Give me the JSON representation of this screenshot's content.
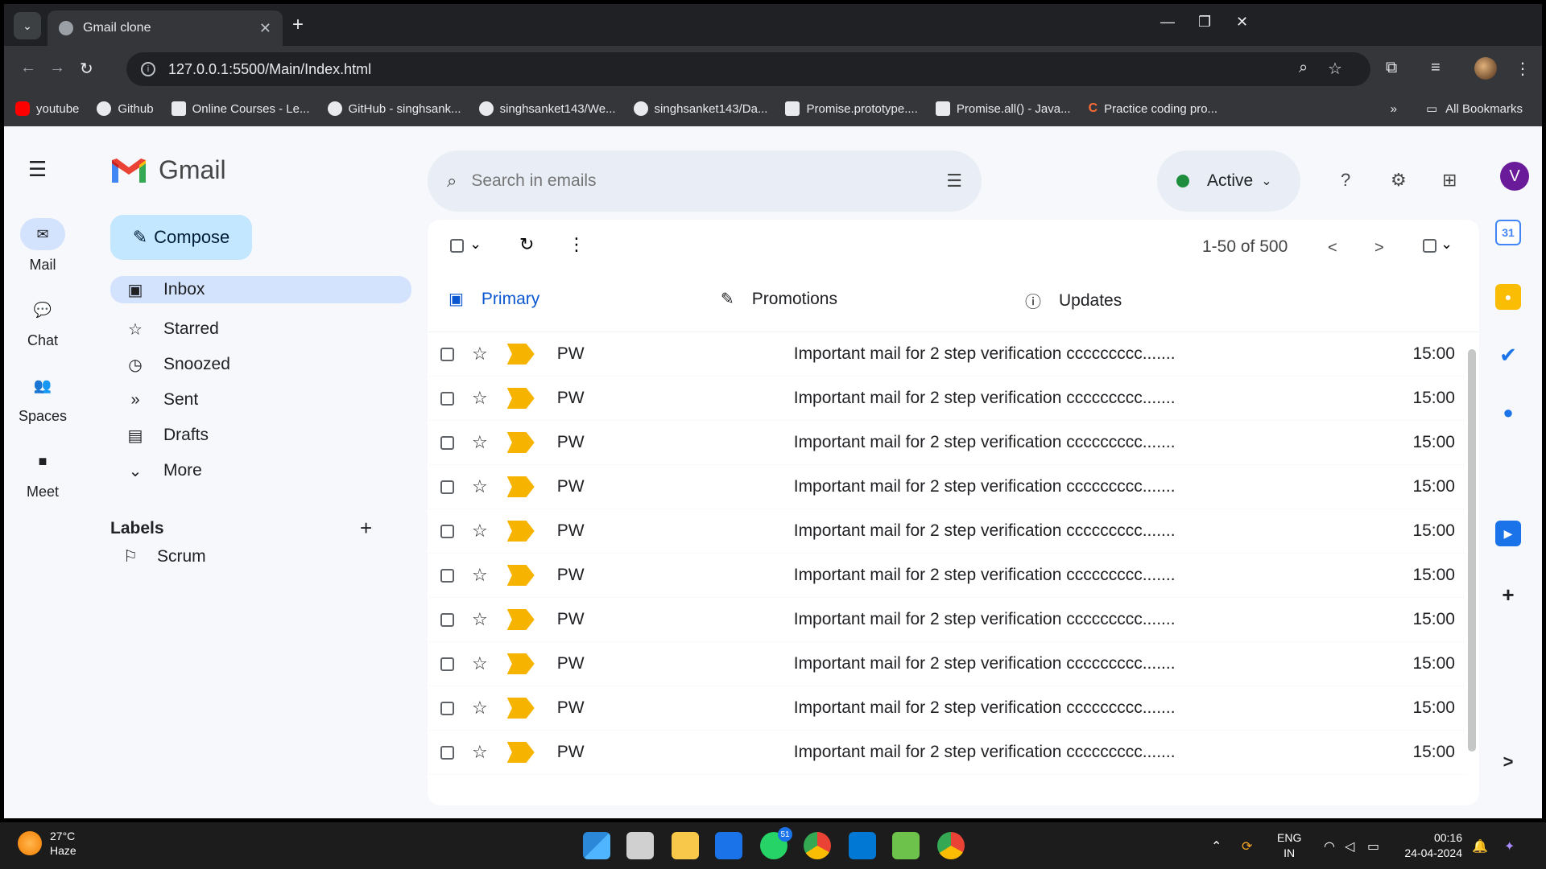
{
  "browser": {
    "tab_title": "Gmail clone",
    "url": "127.0.0.1:5500/Main/Index.html",
    "bookmarks": [
      {
        "label": "youtube",
        "icon": "youtube-icon"
      },
      {
        "label": "Github",
        "icon": "github-icon"
      },
      {
        "label": "Online Courses - Le...",
        "icon": "courses-icon"
      },
      {
        "label": "GitHub - singhsank...",
        "icon": "github-icon"
      },
      {
        "label": "singhsanket143/We...",
        "icon": "github-icon"
      },
      {
        "label": "singhsanket143/Da...",
        "icon": "github-icon"
      },
      {
        "label": "Promise.prototype....",
        "icon": "mdn-icon"
      },
      {
        "label": "Promise.all() - Java...",
        "icon": "mdn-icon"
      },
      {
        "label": "Practice coding pro...",
        "icon": "codechef-icon"
      }
    ],
    "all_bookmarks": "All Bookmarks"
  },
  "rail": {
    "items": [
      {
        "label": "Mail",
        "icon": "mail-icon"
      },
      {
        "label": "Chat",
        "icon": "chat-icon"
      },
      {
        "label": "Spaces",
        "icon": "spaces-icon"
      },
      {
        "label": "Meet",
        "icon": "video-icon"
      }
    ]
  },
  "app": {
    "name": "Gmail",
    "compose": "Compose"
  },
  "nav": {
    "items": [
      {
        "label": "Inbox",
        "icon": "inbox-icon"
      },
      {
        "label": "Starred",
        "icon": "star-icon"
      },
      {
        "label": "Snoozed",
        "icon": "clock-icon"
      },
      {
        "label": "Sent",
        "icon": "send-icon"
      },
      {
        "label": "Drafts",
        "icon": "draft-icon"
      },
      {
        "label": "More",
        "icon": "chevron-down-icon"
      }
    ]
  },
  "labels": {
    "title": "Labels",
    "items": [
      "Scrum"
    ]
  },
  "search": {
    "placeholder": "Search in emails"
  },
  "status": {
    "label": "Active",
    "color": "#1e8e3e"
  },
  "account": {
    "initial": "V",
    "color": "#6a1b9a"
  },
  "list": {
    "range": "1-50 of 500",
    "prev": "<",
    "next": ">",
    "tabs": [
      {
        "label": "Primary",
        "icon": "inbox-icon"
      },
      {
        "label": "Promotions",
        "icon": "pencil-icon"
      },
      {
        "label": "Updates",
        "icon": "info-icon"
      }
    ],
    "emails": [
      {
        "sender": "PW",
        "subject": "Important mail for 2 step verification ccccccccc.......",
        "time": "15:00"
      },
      {
        "sender": "PW",
        "subject": "Important mail for 2 step verification ccccccccc.......",
        "time": "15:00"
      },
      {
        "sender": "PW",
        "subject": "Important mail for 2 step verification ccccccccc.......",
        "time": "15:00"
      },
      {
        "sender": "PW",
        "subject": "Important mail for 2 step verification ccccccccc.......",
        "time": "15:00"
      },
      {
        "sender": "PW",
        "subject": "Important mail for 2 step verification ccccccccc.......",
        "time": "15:00"
      },
      {
        "sender": "PW",
        "subject": "Important mail for 2 step verification ccccccccc.......",
        "time": "15:00"
      },
      {
        "sender": "PW",
        "subject": "Important mail for 2 step verification ccccccccc.......",
        "time": "15:00"
      },
      {
        "sender": "PW",
        "subject": "Important mail for 2 step verification ccccccccc.......",
        "time": "15:00"
      },
      {
        "sender": "PW",
        "subject": "Important mail for 2 step verification ccccccccc.......",
        "time": "15:00"
      },
      {
        "sender": "PW",
        "subject": "Important mail for 2 step verification ccccccccc.......",
        "time": "15:00"
      }
    ],
    "important_color": "#f6b400"
  },
  "side_panel": {
    "calendar_day": "31",
    "expand": ">"
  },
  "taskbar": {
    "temp": "27°C",
    "condition": "Haze",
    "whatsapp_badge": "51",
    "lang1": "ENG",
    "lang2": "IN",
    "time": "00:16",
    "date": "24-04-2024"
  }
}
